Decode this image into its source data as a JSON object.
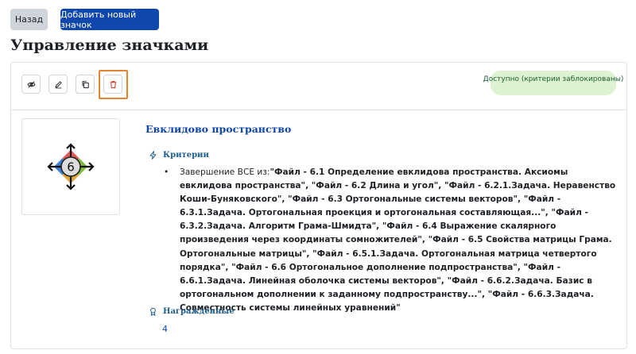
{
  "toolbar": {
    "back_label": "Назад",
    "add_label": "Добавить новый значок"
  },
  "page": {
    "title": "Управление значками"
  },
  "card": {
    "status": "Доступно (критерии заблокированы)",
    "actions": [
      "eye-slash-icon",
      "pencil-icon",
      "copy-icon",
      "trash-icon"
    ],
    "badge_image_text": "6",
    "badge_name": "Евклидово пространство",
    "criteria_heading": "Критерии",
    "criteria_intro": "Завершение ВСЕ из:",
    "criteria_items": "\"Файл - 6.1 Определение евклидова пространства. Аксиомы евклидова пространства\", \"Файл - 6.2 Длина и угол\", \"Файл - 6.2.1.Задача. Неравенство Коши-Буняковского\", \"Файл - 6.3 Ортогональные системы векторов\", \"Файл - 6.3.1.Задача. Ортогональная проекция и ортогональная составляющая...\", \"Файл - 6.3.2.Задача. Алгоритм Грама-Шмидта\", \"Файл - 6.4 Выражение скалярного произведения через координаты сомножителей\", \"Файл - 6.5 Свойства матрицы Грама. Ортогональные матрицы\", \"Файл - 6.5.1.Задача. Ортогональная матрица четвертого порядка\", \"Файл - 6.6 Ортогональное дополнение подпространства\", \"Файл - 6.6.1.Задача. Линейная оболочка системы векторов\", \"Файл - 6.6.2.Задача. Базис в ортогональном дополнении к заданному подпространству...\", \"Файл - 6.6.3.Задача. Совместность системы линейных уравнений\"",
    "awarded_heading": "Награжденные",
    "awarded_count": "4"
  },
  "colors": {
    "primary": "#0f47ad",
    "highlight": "#e8842f",
    "status_bg": "#dcf2d0",
    "status_text": "#1c5e36",
    "delete": "#ca3120"
  }
}
